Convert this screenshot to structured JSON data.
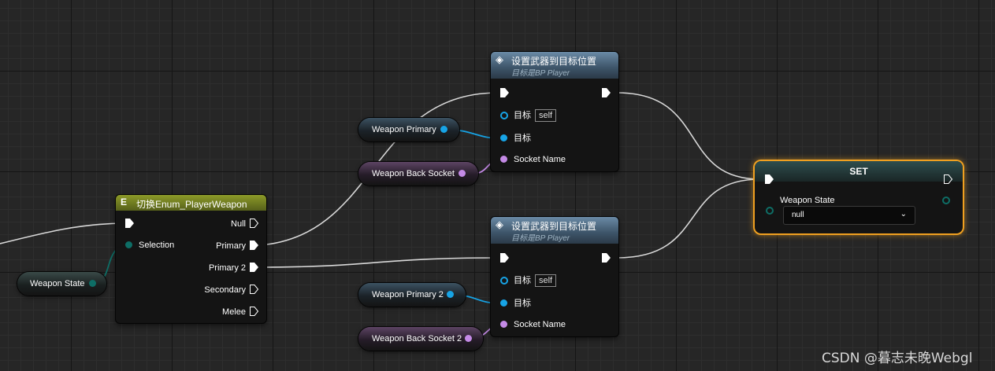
{
  "nodes": {
    "set_weapon_1": {
      "title": "设置武器到目标位置",
      "subtitle": "目标是BP Player",
      "target_label": "目标",
      "target_default": "self",
      "target2_label": "目标",
      "socket_label": "Socket Name"
    },
    "set_weapon_2": {
      "title": "设置武器到目标位置",
      "subtitle": "目标是BP Player",
      "target_label": "目标",
      "target_default": "self",
      "target2_label": "目标",
      "socket_label": "Socket Name"
    },
    "switch_enum": {
      "title": "切换Enum_PlayerWeapon",
      "selection_label": "Selection",
      "outputs": [
        "Null",
        "Primary",
        "Primary 2",
        "Secondary",
        "Melee"
      ]
    },
    "set_var": {
      "title": "SET",
      "var_label": "Weapon State",
      "value": "null"
    }
  },
  "variables": {
    "weapon_primary": "Weapon Primary",
    "weapon_back_socket": "Weapon Back Socket",
    "weapon_state": "Weapon State",
    "weapon_primary_2": "Weapon Primary 2",
    "weapon_back_socket_2": "Weapon Back Socket 2"
  },
  "colors": {
    "object_pin": "#17a4e6",
    "name_pin": "#c48ae6",
    "enum_pin": "#0e6e66",
    "exec": "#ffffff",
    "set_border": "#f0a020"
  },
  "watermark": "CSDN @暮志未晚Webgl"
}
